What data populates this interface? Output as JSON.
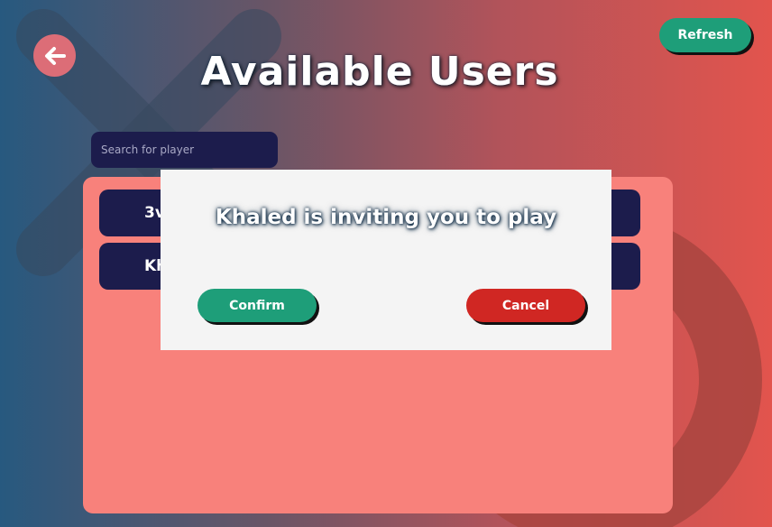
{
  "header": {
    "title": "Available Users",
    "refresh_label": "Refresh"
  },
  "search": {
    "placeholder": "Search for player",
    "value": ""
  },
  "users": [
    {
      "label": "3v"
    },
    {
      "label": "Kh"
    }
  ],
  "modal": {
    "message": "Khaled is inviting you to play",
    "confirm_label": "Confirm",
    "cancel_label": "Cancel"
  },
  "icons": {
    "back": "arrow-left-icon",
    "decoration_x": "x-mark-icon",
    "decoration_o": "circle-o-icon"
  },
  "colors": {
    "primary_button": "#1e9e79",
    "danger_button": "#d02723",
    "dark_panel": "#1c1c4c",
    "list_panel": "#f8817b",
    "modal_bg": "#f4f4f4"
  }
}
